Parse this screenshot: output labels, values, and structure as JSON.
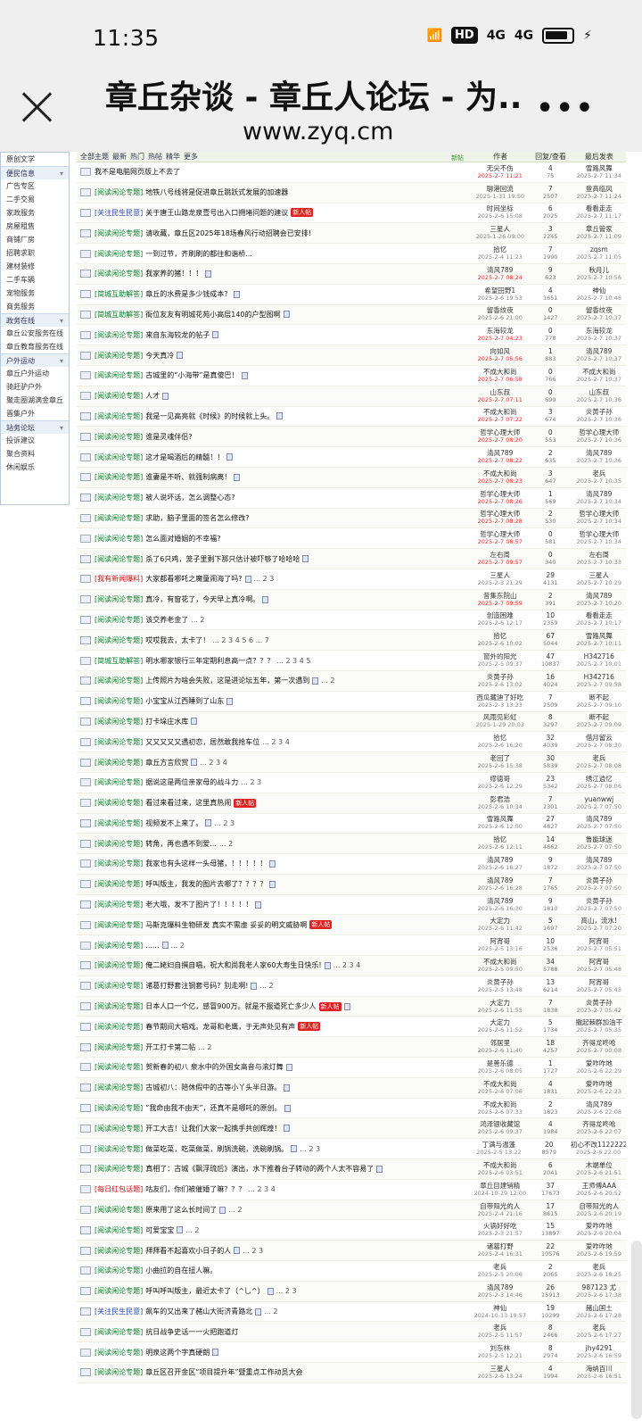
{
  "status": {
    "time": "11:35",
    "hd": "HD",
    "net1": "4G",
    "net2": "4G"
  },
  "browser": {
    "title": "章丘杂谈 - 章丘人论坛 - 为...",
    "url": "www.zyq.cm"
  },
  "sidebar": {
    "top_item": "原创文学",
    "groups": [
      {
        "head": "便民信息",
        "items": [
          "广告专区",
          "二手交易",
          "家政服务",
          "房屋租售",
          "商铺厂房",
          "招聘求职",
          "建材装修",
          "二手车辆",
          "宠物服务",
          "商务服务"
        ]
      },
      {
        "head": "政务在线",
        "items": [
          "章丘公安服务在线",
          "章丘教育服务在线"
        ]
      },
      {
        "head": "户外运动",
        "items": [
          "章丘户外运动",
          "骑赶驴户外",
          "聚走圈湖满金章丘",
          "晋集户外"
        ]
      },
      {
        "head": "站务论坛",
        "items": [
          "投诉建议",
          "聚合资料",
          "休闲娱乐"
        ]
      }
    ]
  },
  "table": {
    "filters": [
      "全部主题",
      "最新",
      "热门",
      "热帖",
      "精华",
      "更多"
    ],
    "new_label": "新帖",
    "headers": {
      "author": "作者",
      "replies": "回复/查看",
      "last": "最后发表"
    },
    "rows": [
      {
        "cat": "",
        "title": "我不是电脑网页版上不去了",
        "author": "无尖不伤",
        "date": "2025-2-7 11:21",
        "today": true,
        "r": "4",
        "v": "75",
        "last": "雪路风舞",
        "ld": "2025-2-7 11:34"
      },
      {
        "cat": "[阅读闲论专题]",
        "title": "地铁八号线将是促进章丘跳跃式发展的加速器",
        "author": "聊港回流",
        "date": "2025-1-31 19:50",
        "r": "7",
        "v": "2507",
        "last": "登高临风",
        "ld": "2025-2-7 11:24"
      },
      {
        "cat": "[关注民生民意]",
        "ccls": "blue",
        "title": "关于唐王山路龙泉壹号出入口拥堵问题的建议",
        "badge": "新人帖",
        "author": "时间坐标",
        "date": "2025-2-6 15:08",
        "r": "6",
        "v": "2025",
        "last": "看看走走",
        "ld": "2025-2-7 11:17"
      },
      {
        "cat": "[阅读闲论专题]",
        "title": "请收藏，章丘区2025年18场春风行动招聘会已安排!",
        "author": "三星人",
        "date": "2025-1-26 09:00",
        "r": "3",
        "v": "2245",
        "last": "章丘管家",
        "ld": "2025-2-7 11:09"
      },
      {
        "cat": "[阅读闲论专题]",
        "title": "一到过节，齐刷刷的都往和谐桥...",
        "author": "拾忆",
        "date": "2025-2-4 11:23",
        "r": "7",
        "v": "1990",
        "last": "zqsm",
        "ld": "2025-2-7 11:05"
      },
      {
        "cat": "[阅读闲论专题]",
        "title": "我家养的猪！！！",
        "att": true,
        "author": "清风789",
        "date": "2025-2-7 08:24",
        "today": true,
        "r": "9",
        "v": "623",
        "last": "秋月儿",
        "ld": "2025-2-7 10:56"
      },
      {
        "cat": "[简城互助解答]",
        "title": "章丘的水费是多少钱成本？",
        "att": true,
        "author": "希望田野1",
        "date": "2025-2-6 19:53",
        "r": "4",
        "v": "1651",
        "last": "神仙",
        "ld": "2025-2-7 10:48"
      },
      {
        "cat": "[简城互助解答]",
        "title": "衙位友友有明城花苑小高层140的户型图啊",
        "att": true,
        "author": "留香纹夜",
        "date": "2025-2-6 21:00",
        "r": "0",
        "v": "1427",
        "last": "留香纹夜",
        "ld": "2025-2-7 10:37"
      },
      {
        "cat": "[阅读闲论专题]",
        "title": "来自东海较龙的帖子",
        "att": true,
        "author": "东海较龙",
        "date": "2025-2-7 04:23",
        "today": true,
        "r": "0",
        "v": "778",
        "last": "东海较龙",
        "ld": "2025-2-7 10:37"
      },
      {
        "cat": "[阅读闲论专题]",
        "title": "今天真冷",
        "att": true,
        "author": "向如风",
        "date": "2025-2-7 05:56",
        "today": true,
        "r": "1",
        "v": "883",
        "last": "清风789",
        "ld": "2025-2-7 10:37"
      },
      {
        "cat": "[阅读闲论专题]",
        "title": "古城里的“小海带”是真傻巴！",
        "att": true,
        "author": "不成大和尚",
        "date": "2025-2-7 06:58",
        "today": true,
        "r": "0",
        "v": "766",
        "last": "不成大和尚",
        "ld": "2025-2-7 10:37"
      },
      {
        "cat": "[阅读闲论专题]",
        "title": "人才",
        "att": true,
        "author": "山东叔",
        "date": "2025-2-7 07:11",
        "today": true,
        "r": "0",
        "v": "699",
        "last": "山东叔",
        "ld": "2025-2-7 10:36"
      },
      {
        "cat": "[阅读闲论专题]",
        "title": "我是一见高亮就《时候》的时候就上头。",
        "att": true,
        "author": "不成大和尚",
        "date": "2025-2-7 07:22",
        "today": true,
        "r": "3",
        "v": "674",
        "last": "炎黄子孙",
        "ld": "2025-2-7 10:36"
      },
      {
        "cat": "[阅读闲论专题]",
        "title": "谁是灵魂伴侣?",
        "author": "哲学心理大师",
        "date": "2025-2-7 08:20",
        "today": true,
        "r": "0",
        "v": "553",
        "last": "哲学心理大师",
        "ld": "2025-2-7 10:36"
      },
      {
        "cat": "[阅读闲论专题]",
        "title": "这才是喝酒后的精髓！！",
        "att": true,
        "author": "清风789",
        "date": "2025-2-7 08:22",
        "today": true,
        "r": "2",
        "v": "635",
        "last": "清风789",
        "ld": "2025-2-7 10:36"
      },
      {
        "cat": "[阅读闲论专题]",
        "title": "谁妻是不听、就强制病离！",
        "att": true,
        "author": "不成大和尚",
        "date": "2025-2-7 08:23",
        "today": true,
        "r": "3",
        "v": "647",
        "last": "老兵",
        "ld": "2025-2-7 10:35"
      },
      {
        "cat": "[阅读闲论专题]",
        "title": "被人说坏话，怎么调整心态?",
        "author": "哲学心理大师",
        "date": "2025-2-7 08:26",
        "today": true,
        "r": "1",
        "v": "569",
        "last": "清风789",
        "ld": "2025-2-7 10:34"
      },
      {
        "cat": "[阅读闲论专题]",
        "title": "求助，脑子里面的签名怎么修改?",
        "author": "哲学心理大师",
        "date": "2025-2-7 08:28",
        "today": true,
        "r": "2",
        "v": "530",
        "last": "哲学心理大师",
        "ld": "2025-2-7 10:34"
      },
      {
        "cat": "[阅读闲论专题]",
        "title": "怎么面对婚姻的不幸福?",
        "author": "哲学心理大师",
        "date": "2025-2-7 08:57",
        "today": true,
        "r": "0",
        "v": "581",
        "last": "哲学心理大师",
        "ld": "2025-2-7 10:34"
      },
      {
        "cat": "[阅读闲论专题]",
        "title": "杀了6只鸡，笼子里剩下那只估计被吓够了哈哈哈",
        "att": true,
        "author": "左右周",
        "date": "2025-2-7 09:57",
        "today": true,
        "r": "0",
        "v": "340",
        "last": "左右周",
        "ld": "2025-2-7 10:33"
      },
      {
        "cat": "[我有新闻爆料]",
        "ccls": "red",
        "title": "大家都看哪吒之魔童闹海了吗?",
        "att": true,
        "pages": "... 2 3",
        "author": "三星人",
        "date": "2025-2-3 21:29",
        "r": "29",
        "v": "4131",
        "last": "三星人",
        "ld": "2025-2-7 10:29"
      },
      {
        "cat": "[阅读闲论专题]",
        "title": "真冷，有窗花了，今天早上真冷啊。",
        "att": true,
        "author": "昔集东院山",
        "date": "2025-2-7 09:59",
        "today": true,
        "r": "2",
        "v": "391",
        "last": "清风789",
        "ld": "2025-2-7 10:20"
      },
      {
        "cat": "[阅读闲论专题]",
        "title": "该交养老金了",
        "pages": "... 2",
        "author": "创造困难",
        "date": "2025-2-6 12:17",
        "r": "10",
        "v": "2359",
        "last": "看看走走",
        "ld": "2025-2-7 10:17"
      },
      {
        "cat": "[阅读闲论专题]",
        "title": "哎哎我去，太卡了！",
        "pages": "... 2 3 4 5 6 ... 7",
        "author": "拾忆",
        "date": "2025-2-6 10:02",
        "r": "67",
        "v": "5044",
        "last": "雪路风舞",
        "ld": "2025-2-7 10:11"
      },
      {
        "cat": "[简城互助解答]",
        "title": "明水哪家银行三年定期利息高一点？？？",
        "pages": "... 2 3 4 5",
        "author": "窗外的阳光",
        "date": "2025-2-5 09:37",
        "r": "47",
        "v": "10837",
        "last": "H342716",
        "ld": "2025-2-7 10:01"
      },
      {
        "cat": "[阅读闲论专题]",
        "title": "上传照片为啥会失败，这是进论坛五年，第一次遇到",
        "att": true,
        "pages": "... 2",
        "author": "炎黄子孙",
        "date": "2025-2-6 13:02",
        "r": "16",
        "v": "4024",
        "last": "H342716",
        "ld": "2025-2-7 09:58"
      },
      {
        "cat": "[阅读闲论专题]",
        "title": "小宝宝从江西睡到了山东",
        "att": true,
        "author": "西瓜藏迪了好吃",
        "date": "2025-2-3 13:23",
        "r": "7",
        "v": "2509",
        "last": "断不起",
        "ld": "2025-2-7 09:10"
      },
      {
        "cat": "[阅读闲论专题]",
        "title": "打卡垛庄水库",
        "att": true,
        "author": "风雨见彩虹",
        "date": "2025-1-29 20:03",
        "r": "8",
        "v": "3297",
        "last": "断不起",
        "ld": "2025-2-7 09:09"
      },
      {
        "cat": "[阅读闲论专题]",
        "title": "又又又又又遇初恋，居然敢我抢车位",
        "pages": "... 2 3 4",
        "author": "拾忆",
        "date": "2025-2-6 16:20",
        "r": "32",
        "v": "4039",
        "last": "借月留云",
        "ld": "2025-2-7 08:30"
      },
      {
        "cat": "[阅读闲论专题]",
        "title": "章丘方言欣赏",
        "att": true,
        "pages": "... 2 3 4",
        "author": "老回了",
        "date": "2025-2-6 15:38",
        "r": "30",
        "v": "5839",
        "last": "老兵",
        "ld": "2025-2-7 08:08"
      },
      {
        "cat": "[阅读闲论专题]",
        "title": "据说这是两位亲家母的战斗力",
        "pages": "... 2 3",
        "author": "缪德哥",
        "date": "2025-2-6 12:29",
        "r": "23",
        "v": "5342",
        "last": "绣江逍忆",
        "ld": "2025-2-7 08:06"
      },
      {
        "cat": "[阅读闲论专题]",
        "title": "看过来看过来，这里真热闹",
        "badge": "新人帖",
        "author": "彭君浩",
        "date": "2025-2-6 10:34",
        "r": "7",
        "v": "2301",
        "last": "yuanwwj",
        "ld": "2025-2-7 07:50"
      },
      {
        "cat": "[阅读闲论专题]",
        "title": "视频发不上来了。",
        "att": true,
        "pages": "... 2 3",
        "author": "雪路风舞",
        "date": "2025-2-6 12:00",
        "r": "27",
        "v": "4827",
        "last": "清风789",
        "ld": "2025-2-7 07:50"
      },
      {
        "cat": "[阅读闲论专题]",
        "title": "转角，再也遇不到爱...",
        "pages": "... 2",
        "author": "拾忆",
        "date": "2025-2-6 12:11",
        "r": "14",
        "v": "4662",
        "last": "鲁能球迷",
        "ld": "2025-2-7 07:50"
      },
      {
        "cat": "[阅读闲论专题]",
        "title": "我家也有头这样一头母猪，！！！！！",
        "att": true,
        "author": "清风789",
        "date": "2025-2-6 16:27",
        "r": "9",
        "v": "1872",
        "last": "清风789",
        "ld": "2025-2-7 07:50"
      },
      {
        "cat": "[阅读闲论专题]",
        "title": "呼叫版主，我发的图片去哪了？？？？",
        "att": true,
        "author": "清风789",
        "date": "2025-2-6 16:28",
        "r": "7",
        "v": "1765",
        "last": "炎黄子孙",
        "ld": "2025-2-7 07:50"
      },
      {
        "cat": "[阅读闲论专题]",
        "title": "老大哦，发不了图片了！！！！！",
        "att": true,
        "author": "清风789",
        "date": "2025-2-6 16:30",
        "r": "9",
        "v": "1810",
        "last": "炎黄子孙",
        "ld": "2025-2-7 07:50"
      },
      {
        "cat": "[阅读闲论专题]",
        "title": "马斯克爆料生物研发 真实不需虚 妥妥的明文威胁啊",
        "badge": "新人帖",
        "author": "大定力",
        "date": "2025-2-6 11:42",
        "r": "5",
        "v": "1697",
        "last": "高山，流水!",
        "ld": "2025-2-7 07:20"
      },
      {
        "cat": "[阅读闲论专题]",
        "title": "......",
        "att": true,
        "pages": "... 2",
        "author": "阿宵哥",
        "date": "2025-2-5 13:16",
        "r": "10",
        "v": "2536",
        "last": "阿宵哥",
        "ld": "2025-2-7 05:51"
      },
      {
        "cat": "[阅读闲论专题]",
        "title": "俺二姥妇自撰自唱，祝大和尚我老人家60大寿生日快乐!",
        "att": true,
        "pages": "... 2 3 4",
        "author": "不成大和尚",
        "date": "2025-2-5 09:50",
        "r": "34",
        "v": "5788",
        "last": "阿宵哥",
        "ld": "2025-2-7 05:48"
      },
      {
        "cat": "[阅读闲论专题]",
        "title": "诸葛打野套注钢套号码？别走啊!",
        "att": true,
        "pages": "... 2",
        "author": "炎黄子孙",
        "date": "2025-2-5 13:48",
        "r": "13",
        "v": "6214",
        "last": "阿宵哥",
        "ld": "2025-2-7 05:43"
      },
      {
        "cat": "[阅读闲论专题]",
        "title": "日本人口一个亿，感冒900万。就是不报道死亡多少人",
        "badge": "新人帖",
        "att": true,
        "author": "大定力",
        "date": "2025-2-6 11:55",
        "r": "7",
        "v": "1838",
        "last": "炎黄子孙",
        "ld": "2025-2-7 05:42"
      },
      {
        "cat": "[阅读闲论专题]",
        "title": "春节期间大唱戏。龙哥和老鹰，于无声处见有声",
        "badge": "新人帖",
        "author": "大定力",
        "date": "2025-2-6 11:52",
        "r": "5",
        "v": "1734",
        "last": "撒起棘群加油干",
        "ld": "2025-2-7 05:35"
      },
      {
        "cat": "[阅读闲论专题]",
        "title": "开工打卡第二帖",
        "pages": "... 2",
        "author": "邻居里",
        "date": "2025-2-6 11:40",
        "r": "18",
        "v": "4257",
        "last": "齐得龙咚呛",
        "ld": "2025-2-7 00:08"
      },
      {
        "cat": "[阅读闲论专题]",
        "title": "贺新春的初八 泉水中的外国女高音与滚灯舞",
        "att": true,
        "author": "是善乐德",
        "date": "2025-2-6 08:05",
        "r": "1",
        "v": "1727",
        "last": "爱咋咋地",
        "ld": "2025-2-6 22:29"
      },
      {
        "cat": "[阅读闲论专题]",
        "title": "古城初八：陪休假中的古等小丫头半日游。",
        "att": true,
        "author": "不成大和尚",
        "date": "2025-2-6 07:06",
        "r": "4",
        "v": "1831",
        "last": "爱咋咋地",
        "ld": "2025-2-6 22:23"
      },
      {
        "cat": "[阅读闲论专题]",
        "title": "“我命由我不由天”，还真不是哪吒的原创。",
        "att": true,
        "author": "不成大和尚",
        "date": "2025-2-6 07:33",
        "r": "2",
        "v": "1823",
        "last": "清风789",
        "ld": "2025-2-6 22:08"
      },
      {
        "cat": "[阅读闲论专题]",
        "title": "开工大吉！让我们大家一起携手共创辉煌！",
        "att": true,
        "author": "鸿泽银收藏馆",
        "date": "2025-2-6 09:37",
        "r": "4",
        "v": "1984",
        "last": "齐得龙咚呛",
        "ld": "2025-2-6 22:07"
      },
      {
        "cat": "[阅读闲论专题]",
        "title": "做菜吃菜，吃菜做菜，刷锅洗碗，洗碗刷锅。",
        "att": true,
        "pages": "... 2 3",
        "author": "丁满与温蓬",
        "date": "2025-2-5 13:22",
        "r": "20",
        "v": "8579",
        "last": "初心不改1122222",
        "ld": "2025-2-6 22:00"
      },
      {
        "cat": "[阅读闲论专题]",
        "title": "真相了：古城《飘浮琉后》演出，水下推着台子转动的两个人太不容易了",
        "att": true,
        "author": "不成大和尚",
        "date": "2025-2-6 03:51",
        "r": "6",
        "v": "2041",
        "last": "木端单位",
        "ld": "2025-2-6 21:51"
      },
      {
        "cat": "[每日红包话题]",
        "ccls": "red",
        "title": "咕友们，你们被催婚了嘛？？？",
        "pages": "... 2 3 4",
        "author": "章丘目建销精",
        "date": "2024-10-29 12:00",
        "r": "37",
        "v": "17673",
        "last": "王师傅AAA",
        "ld": "2025-2-6 20:52"
      },
      {
        "cat": "[阅读闲论专题]",
        "title": "原来用了这么长时间了",
        "att": true,
        "pages": "... 2",
        "author": "自带阳光的人",
        "date": "2025-2-4 21:16",
        "r": "17",
        "v": "8615",
        "last": "自带阳光的人",
        "ld": "2025-2-6 20:19"
      },
      {
        "cat": "[阅读闲论专题]",
        "title": "可爱宝宝",
        "att": true,
        "pages": "... 2",
        "author": "火锅好好吃",
        "date": "2025-2-3 21:57",
        "r": "15",
        "v": "13897",
        "last": "爱咋咋地",
        "ld": "2025-2-6 20:04"
      },
      {
        "cat": "[阅读闲论专题]",
        "title": "拜拜看不起喜欢小日子的人",
        "att": true,
        "pages": "... 2 3",
        "author": "诸葛打野",
        "date": "2025-2-4 16:31",
        "r": "22",
        "v": "10576",
        "last": "爱咋咋地",
        "ld": "2025-2-6 19:59"
      },
      {
        "cat": "[阅读闲论专题]",
        "title": "小曲拉的自在扭人嘛。",
        "author": "老兵",
        "date": "2025-2-5 20:06",
        "r": "2",
        "v": "2065",
        "last": "老兵",
        "ld": "2025-2-6 18:25"
      },
      {
        "cat": "[阅读闲论专题]",
        "title": "呼叫呼叫版主，最近太卡了（^乚^）",
        "att": true,
        "pages": "... 2 3",
        "author": "清风789",
        "date": "2025-2-3 14:46",
        "r": "26",
        "v": "15913",
        "last": "987123 尤",
        "ld": "2025-2-6 17:38"
      },
      {
        "cat": "[关注民生民意]",
        "ccls": "blue",
        "title": "飙车的又出来了赭山大街济青路北",
        "att": true,
        "pages": "... 2",
        "author": "神仙",
        "date": "2024-10-13 19:57",
        "r": "19",
        "v": "10299",
        "last": "赭山国土",
        "ld": "2025-2-6 17:28"
      },
      {
        "cat": "[阅读闲论专题]",
        "title": "抗日战争史话一一火把跑道灯",
        "author": "老兵",
        "date": "2025-2-5 11:57",
        "r": "8",
        "v": "2466",
        "last": "老兵",
        "ld": "2025-2-6 17:27"
      },
      {
        "cat": "[阅读闲论专题]",
        "title": "明泉这两个字真硬朗",
        "att": true,
        "author": "刘东林",
        "date": "2025-2-5 12:21",
        "r": "8",
        "v": "2974",
        "last": "jhy4291",
        "ld": "2025-2-6 16:59"
      },
      {
        "cat": "[阅读闲论专题]",
        "title": "章丘区召开金区“项目提升年”暨重点工作动员大会",
        "author": "三星人",
        "date": "2025-2-6 13:24",
        "r": "4",
        "v": "1994",
        "last": "海纳百川",
        "ld": "2025-2-6 16:51"
      }
    ]
  }
}
